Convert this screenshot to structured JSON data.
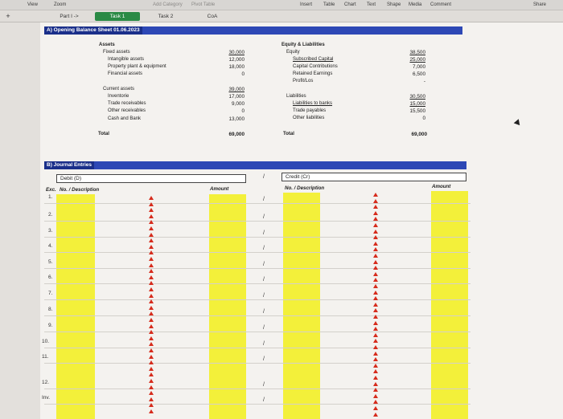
{
  "toolbar": {
    "items_left": [
      "View",
      "Zoom"
    ],
    "items_mid": [
      "Add Category",
      "Pivot Table"
    ],
    "items_right": [
      "Insert",
      "Table",
      "Chart",
      "Text",
      "Shape",
      "Media",
      "Comment"
    ],
    "share": "Share",
    "plus": "+"
  },
  "tabs": [
    "Part I ->",
    "Task 1",
    "Task 2",
    "CoA"
  ],
  "section_a": {
    "title": "A) Opening Balance Sheet 01.06.2023",
    "assets_heading": "Assets",
    "fixed_assets": "Fixed assets",
    "fixed_items": [
      "Intangible assets",
      "Property plant & equipment",
      "Financial assets"
    ],
    "fixed_values": [
      "30,000",
      "12,000",
      "18,000",
      "0"
    ],
    "current_assets": "Current assets",
    "current_items": [
      "Inventorie",
      "Trade receivables",
      "Other receivables",
      "Cash and Bank"
    ],
    "current_values": [
      "39,000",
      "17,000",
      "9,000",
      "0",
      "13,000"
    ],
    "equity_heading": "Equity & Liabilities",
    "equity": "Equity",
    "equity_items": [
      "Subscribed Capital",
      "Capital Contributions",
      "Retained Earnings",
      "Profit/Los"
    ],
    "equity_values": [
      "38,500",
      "25,000",
      "7,000",
      "6,500",
      "-"
    ],
    "liabilities": "Liabilities",
    "liability_items": [
      "Liabilities to banks",
      "Trade payables",
      "Other liabilities"
    ],
    "liability_values": [
      "30,500",
      "15,000",
      "15,500",
      "0"
    ],
    "total_label": "Total",
    "total_left": "69,000",
    "total_right": "69,000"
  },
  "section_b": {
    "title": "B) Journal Entries",
    "debit": "Debit (D)",
    "credit": "Credit (Cr)",
    "exc_header": "Exc.",
    "desc_header": "No. / Description",
    "amount_header": "Amount",
    "slash_header": "/",
    "rows": [
      "1.",
      "2.",
      "3.",
      "4.",
      "5.",
      "6.",
      "7.",
      "8.",
      "9.",
      "10.",
      "11.",
      "12.",
      "Inv."
    ],
    "slash": "/"
  },
  "colors": {
    "section_bar": "#2d48b5",
    "highlight": "#f3f03a",
    "arrow": "#d62b1c",
    "active_tab": "#2a8a45"
  }
}
